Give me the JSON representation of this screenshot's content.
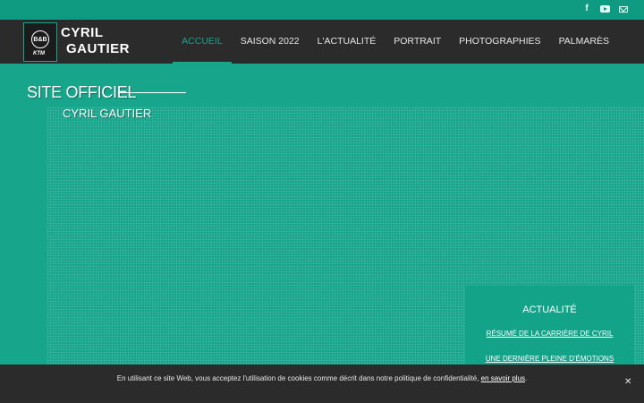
{
  "social": {
    "icons": [
      "facebook-icon",
      "youtube-icon",
      "mail-icon"
    ]
  },
  "brand": {
    "badge": "B&B",
    "sponsor": "KTM",
    "line1": "CYRIL",
    "line2": "GAUTIER"
  },
  "nav": {
    "items": [
      {
        "label": "ACCUEIL",
        "active": true
      },
      {
        "label": "SAISON 2022",
        "active": false
      },
      {
        "label": "L'ACTUALITÉ",
        "active": false
      },
      {
        "label": "PORTRAIT",
        "active": false
      },
      {
        "label": "PHOTOGRAPHIES",
        "active": false
      },
      {
        "label": "PALMARÈS",
        "active": false
      }
    ]
  },
  "hero": {
    "title": "SITE OFFICIEL",
    "subtitle": "CYRIL GAUTIER"
  },
  "news": {
    "heading": "ACTUALITÉ",
    "links": [
      "RÉSUMÉ DE LA CARRIÈRE DE CYRIL",
      "UNE DERNIÈRE PLEINE D'ÉMOTIONS"
    ]
  },
  "cookie": {
    "text": "En utilisant ce site Web, vous acceptez l'utilisation de cookies comme décrit dans notre politique de confidentialité, ",
    "link": "en savoir plus",
    "suffix": ".",
    "close": "✕"
  },
  "colors": {
    "accent": "#17a58c",
    "header": "#2b2b2b",
    "topbar": "#0f9a82"
  }
}
